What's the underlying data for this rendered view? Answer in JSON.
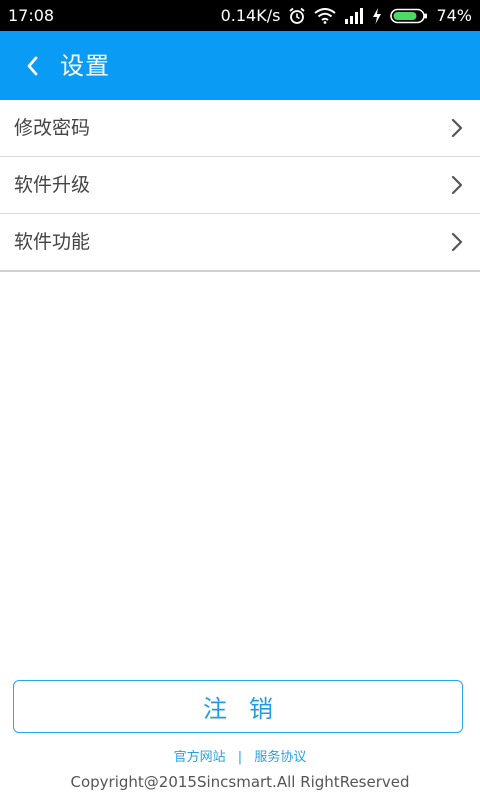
{
  "status_bar": {
    "time": "17:08",
    "network_speed": "0.14K/s",
    "battery_percent": "74%",
    "icons": [
      "alarm-icon",
      "wifi-icon",
      "signal-icon",
      "charging-icon",
      "battery-icon"
    ]
  },
  "app_bar": {
    "title": "设置",
    "back_icon": "chevron-left-icon",
    "background_color": "#0a9cf5"
  },
  "settings": {
    "items": [
      {
        "label": "修改密码"
      },
      {
        "label": "软件升级"
      },
      {
        "label": "软件功能"
      }
    ]
  },
  "logout": {
    "label": "注销",
    "accent_color": "#29a8e6"
  },
  "footer": {
    "link_official": "官方网站",
    "separator": "|",
    "link_agreement": "服务协议",
    "copyright": "Copyright@2015Sincsmart.All  RightReserved"
  }
}
